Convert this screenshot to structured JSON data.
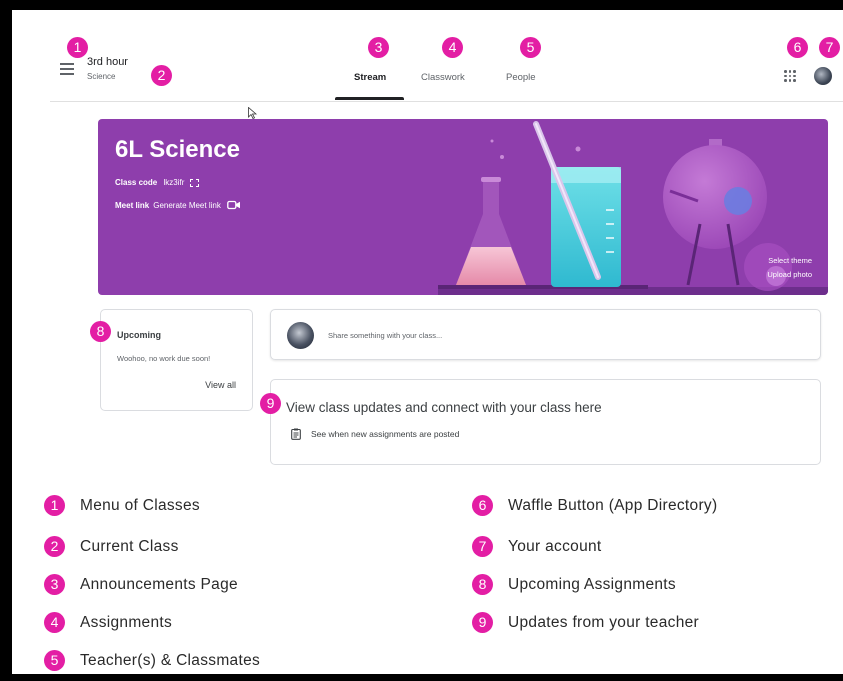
{
  "header": {
    "class_title": "3rd hour",
    "class_subtitle": "Science",
    "tabs": [
      {
        "label": "Stream",
        "active": true
      },
      {
        "label": "Classwork",
        "active": false
      },
      {
        "label": "People",
        "active": false
      }
    ]
  },
  "banner": {
    "title": "6L Science",
    "class_code_label": "Class code",
    "class_code": "lkz3ifr",
    "meet_label": "Meet link",
    "meet_action": "Generate Meet link",
    "select_theme": "Select theme",
    "upload_photo": "Upload photo",
    "color": "#8e3eac"
  },
  "upcoming": {
    "title": "Upcoming",
    "text": "Woohoo, no work due soon!",
    "view_all": "View all"
  },
  "share": {
    "placeholder": "Share something with your class..."
  },
  "updates": {
    "title": "View class updates and connect with your class here",
    "subtitle": "See when new assignments are posted"
  },
  "markers": [
    "1",
    "2",
    "3",
    "4",
    "5",
    "6",
    "7",
    "8",
    "9"
  ],
  "legend": [
    {
      "num": "1",
      "text": "Menu of Classes"
    },
    {
      "num": "2",
      "text": "Current Class"
    },
    {
      "num": "3",
      "text": "Announcements Page"
    },
    {
      "num": "4",
      "text": "Assignments"
    },
    {
      "num": "5",
      "text": "Teacher(s) & Classmates"
    },
    {
      "num": "6",
      "text": "Waffle Button (App Directory)"
    },
    {
      "num": "7",
      "text": "Your account"
    },
    {
      "num": "8",
      "text": "Upcoming Assignments"
    },
    {
      "num": "9",
      "text": "Updates from your teacher"
    }
  ],
  "colors": {
    "marker": "#e31ea4",
    "banner": "#8e3eac"
  }
}
